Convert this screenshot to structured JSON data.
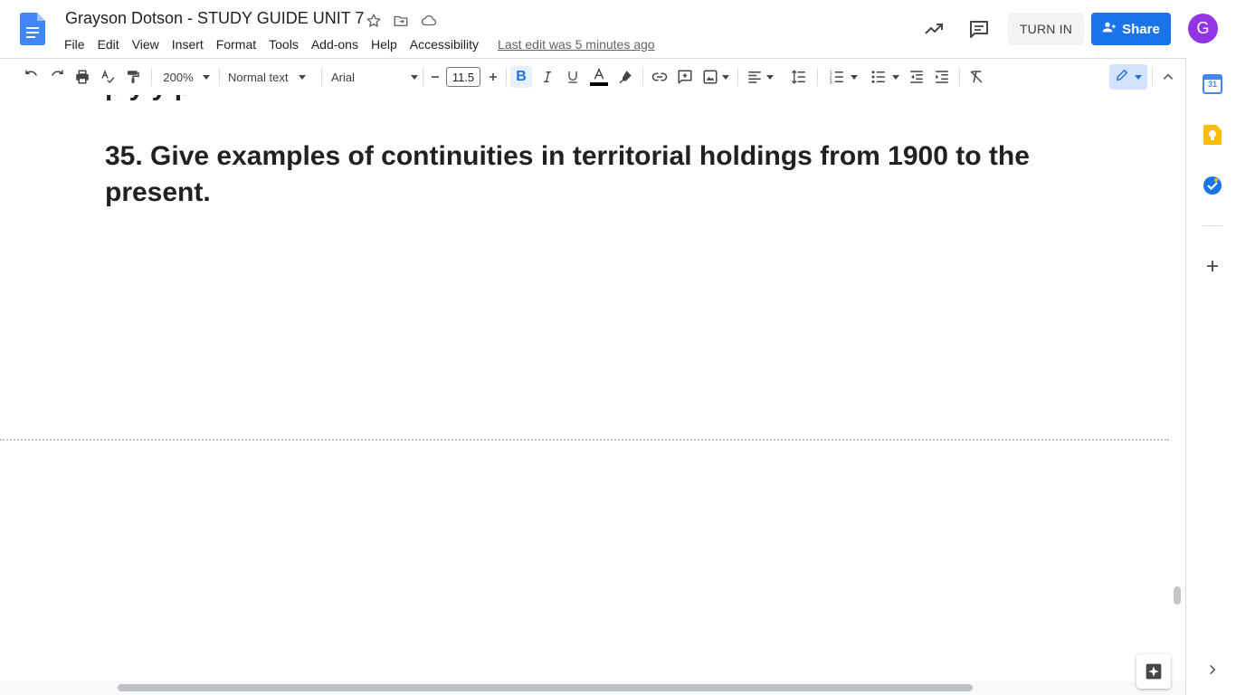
{
  "document": {
    "title": "Grayson Dotson - STUDY GUIDE UNIT 7",
    "last_edit": "Last edit was 5 minutes ago",
    "question": "35. Give examples of continuities in territorial holdings from 1900 to the present.",
    "cut_off_line_fragment": "p                y                                                                        y       p"
  },
  "menu": [
    "File",
    "Edit",
    "View",
    "Insert",
    "Format",
    "Tools",
    "Add-ons",
    "Help",
    "Accessibility"
  ],
  "header": {
    "turn_in_label": "TURN IN",
    "share_label": "Share",
    "avatar_initial": "G"
  },
  "toolbar": {
    "zoom": "200%",
    "style": "Normal text",
    "font": "Arial",
    "font_size": "11.5",
    "bold_glyph": "B"
  },
  "side_panel": {
    "calendar_day": "31"
  },
  "colors": {
    "share_blue": "#1a73e8",
    "avatar_purple": "#9334e6",
    "docs_blue": "#4285f4",
    "keep_yellow": "#fbbc04"
  },
  "icons": [
    "docs-logo-icon",
    "star-icon",
    "move-folder-icon",
    "cloud-saved-icon",
    "activity-trend-icon",
    "comments-icon",
    "undo-icon",
    "redo-icon",
    "print-icon",
    "spellcheck-icon",
    "paint-format-icon",
    "link-icon",
    "add-comment-icon",
    "insert-image-icon",
    "align-left-icon",
    "line-spacing-icon",
    "numbered-list-icon",
    "bulleted-list-icon",
    "decrease-indent-icon",
    "increase-indent-icon",
    "clear-formatting-icon",
    "editing-mode-icon",
    "collapse-toolbar-icon",
    "calendar-icon",
    "keep-icon",
    "tasks-icon",
    "add-addon-icon",
    "expand-panel-icon",
    "explore-icon"
  ]
}
